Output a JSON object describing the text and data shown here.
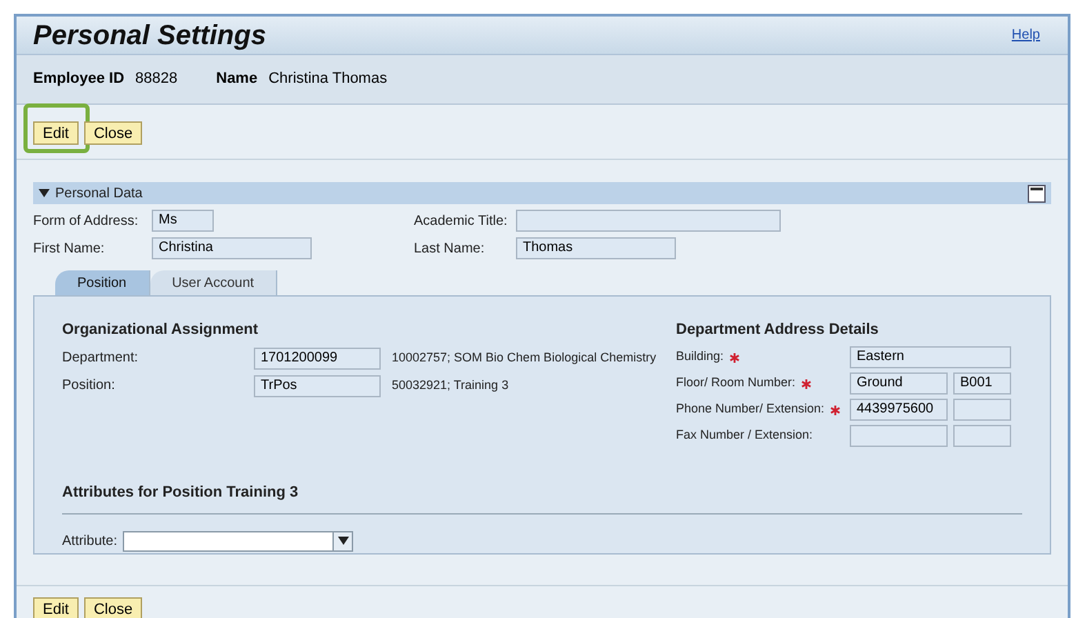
{
  "window": {
    "title": "Personal Settings",
    "help_link": "Help"
  },
  "employee": {
    "id_label": "Employee ID",
    "id": "88828",
    "name_label": "Name",
    "name": "Christina Thomas"
  },
  "top_buttons": [
    {
      "label": "Edit",
      "highlighted": true
    },
    {
      "label": "Close",
      "highlighted": false
    }
  ],
  "section": {
    "title": "Personal Data",
    "expanded": true,
    "fields": [
      {
        "label": "Form of Address:",
        "value": "Ms"
      },
      {
        "label": "Academic Title:"
      },
      {
        "label": "First Name:",
        "value": "Christina"
      },
      {
        "label": "Last Name:",
        "value": "Thomas"
      }
    ]
  },
  "tabs": [
    {
      "label": "Position",
      "selected": true
    },
    {
      "label": "User Account",
      "selected": false
    }
  ],
  "org": {
    "title": "Organizational Assignment",
    "rows": [
      {
        "label": "Department:",
        "value": "1701200099",
        "description": "10002757; SOM Bio Chem Biological Chemistry"
      },
      {
        "label": "Position:",
        "value": "TrPos",
        "description": "50032921; Training 3"
      }
    ]
  },
  "address": {
    "title": "Department Address Details",
    "rows": [
      {
        "label": "Building:",
        "required": true,
        "kind": "single",
        "values": [
          "Eastern"
        ]
      },
      {
        "label": "Floor/ Room Number:",
        "required": true,
        "kind": "pair",
        "values": [
          "Ground",
          "B001"
        ]
      },
      {
        "label": "Phone Number/ Extension:",
        "required": true,
        "kind": "pair",
        "values": [
          "4439975600"
        ]
      },
      {
        "label": "Fax Number / Extension:",
        "required": false,
        "kind": "pair"
      }
    ]
  },
  "attributes": {
    "title": "Attributes for Position Training 3",
    "label": "Attribute:"
  },
  "bottom_buttons": [
    {
      "label": "Edit"
    },
    {
      "label": "Close"
    }
  ]
}
